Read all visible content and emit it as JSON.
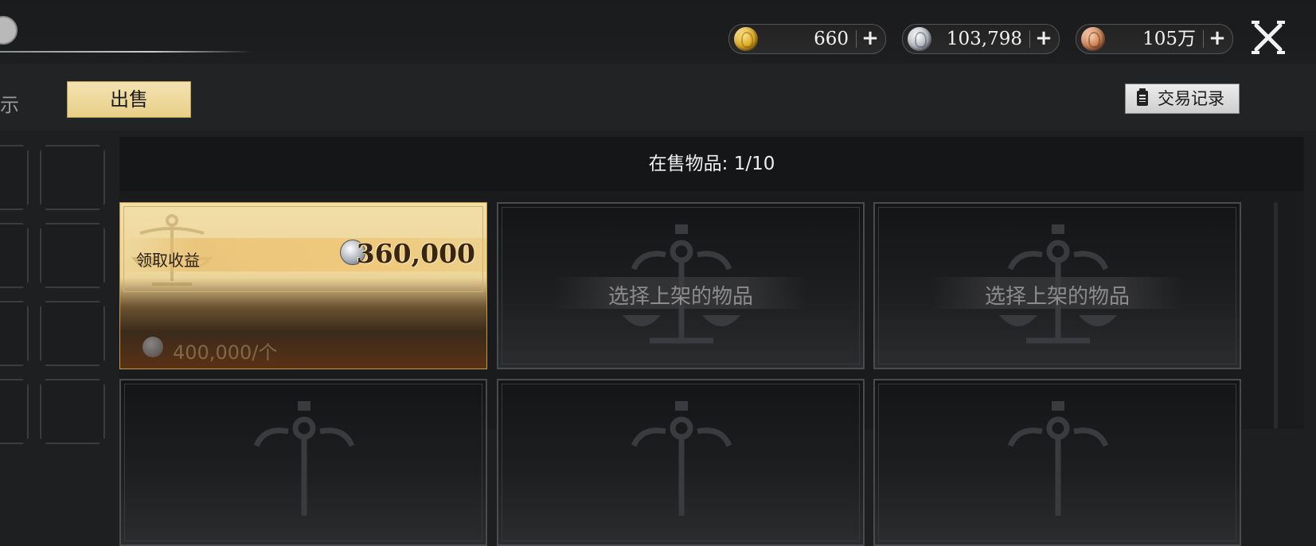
{
  "currencies": [
    {
      "name": "gold",
      "icon": "gold-coin-icon",
      "amount": "660"
    },
    {
      "name": "silver",
      "icon": "silver-coin-icon",
      "amount": "103,798"
    },
    {
      "name": "bronze",
      "icon": "bronze-coin-icon",
      "amount": "105万"
    }
  ],
  "plus_label": "+",
  "tabs": {
    "partial_label": "示",
    "sell_label": "出售"
  },
  "trade_log_label": "交易记录",
  "listing": {
    "header": "在售物品: 1/10",
    "sold_item": {
      "claim_label": "领取收益",
      "claim_amount": "360,000",
      "unit_price": "400,000/个"
    },
    "empty_slot_label": "选择上架的物品"
  },
  "colors": {
    "accent_tab": "#e8cf88",
    "sold_card": "#ecd599"
  }
}
